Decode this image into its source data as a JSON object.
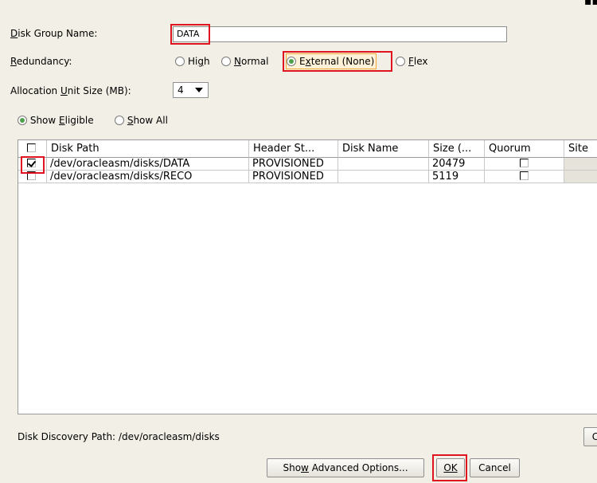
{
  "form": {
    "disk_group_name": {
      "label": "Disk Group Name:",
      "value": "DATA"
    },
    "redundancy": {
      "label": "Redundancy:",
      "options": [
        "High",
        "Normal",
        "External (None)",
        "Flex"
      ],
      "selected": "External (None)"
    },
    "allocation_unit": {
      "label": "Allocation Unit Size (MB):",
      "value": "4"
    },
    "filter": {
      "options": [
        "Show Eligible",
        "Show All"
      ],
      "selected": "Show Eligible"
    }
  },
  "table": {
    "columns": [
      "Disk Path",
      "Header St...",
      "Disk Name",
      "Size (...",
      "Quorum",
      "Site"
    ],
    "rows": [
      {
        "selected": true,
        "path": "/dev/oracleasm/disks/DATA",
        "header": "PROVISIONED",
        "name": "",
        "size": "20479",
        "quorum": false
      },
      {
        "selected": false,
        "path": "/dev/oracleasm/disks/RECO",
        "header": "PROVISIONED",
        "name": "",
        "size": "5119",
        "quorum": false
      }
    ]
  },
  "discovery": {
    "label": "Disk Discovery Path:",
    "path": "/dev/oracleasm/disks",
    "change_button": "C"
  },
  "buttons": {
    "advanced": "Show Advanced Options...",
    "ok": "OK",
    "cancel": "Cancel"
  },
  "colors": {
    "highlight": "#e0141e",
    "window_bg": "#f2efe6",
    "radio_selected": "#4da14b",
    "focus": "#f0a830"
  }
}
